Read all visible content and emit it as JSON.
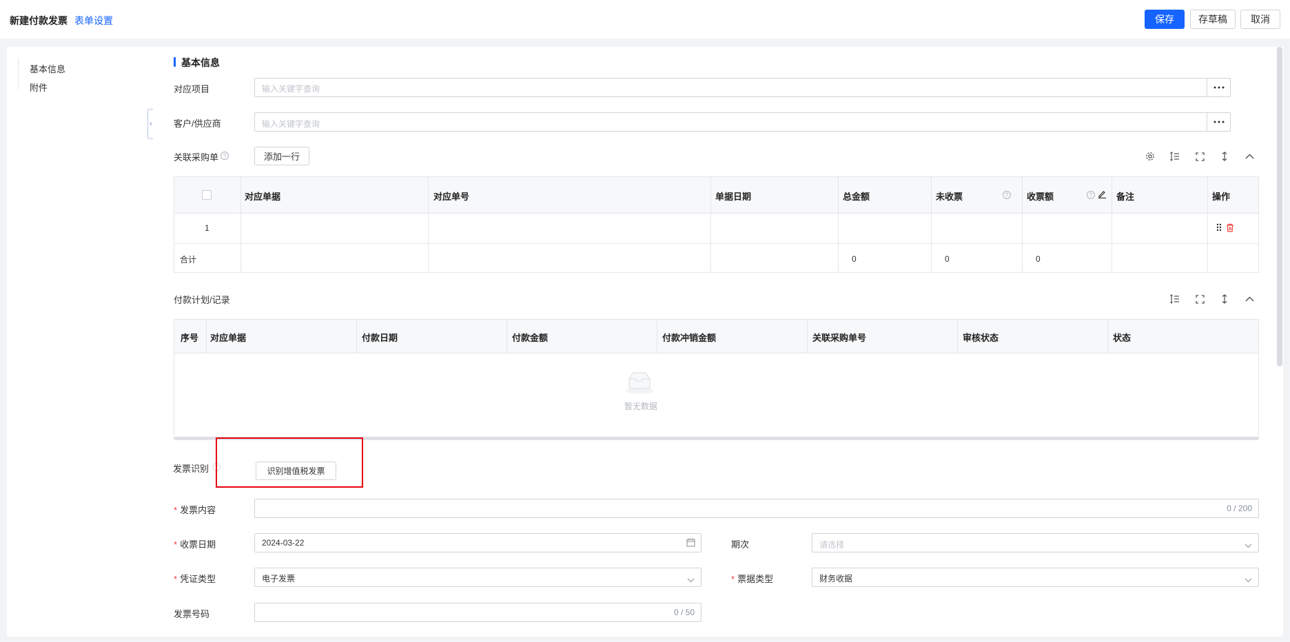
{
  "header": {
    "title": "新建付款发票",
    "form_settings": "表单设置",
    "save": "保存",
    "draft": "存草稿",
    "cancel": "取消"
  },
  "sidebar": {
    "items": [
      {
        "label": "基本信息"
      },
      {
        "label": "附件"
      }
    ]
  },
  "basic": {
    "section_title": "基本信息",
    "project": {
      "label": "对应项目",
      "placeholder": "输入关键字查询"
    },
    "customer": {
      "label": "客户/供应商",
      "placeholder": "输入关键字查询"
    }
  },
  "purchase": {
    "label": "关联采购单",
    "add_row": "添加一行",
    "columns": [
      "对应单据",
      "对应单号",
      "单据日期",
      "总金额",
      "未收票",
      "收票额",
      "备注",
      "操作"
    ],
    "rows": [
      {
        "index": "1"
      }
    ],
    "total": {
      "label": "合计",
      "total_amount": "0",
      "unbilled": "0",
      "billed": "0"
    }
  },
  "payment_plan": {
    "label": "付款计划/记录",
    "columns": [
      "序号",
      "对应单据",
      "付款日期",
      "付款金额",
      "付款冲销金额",
      "关联采购单号",
      "审核状态",
      "状态"
    ],
    "empty": "暂无数据"
  },
  "invoice": {
    "recognize_label": "发票识别",
    "recognize_button": "识别增值税发票",
    "content": {
      "label": "发票内容",
      "counter": "0 / 200"
    },
    "date": {
      "label": "收票日期",
      "value": "2024-03-22"
    },
    "period": {
      "label": "期次",
      "placeholder": "请选择"
    },
    "voucher": {
      "label": "凭证类型",
      "value": "电子发票"
    },
    "ticket_type": {
      "label": "票据类型",
      "value": "财务收据"
    },
    "number": {
      "label": "发票号码",
      "counter": "0 / 50"
    }
  },
  "colors": {
    "accent": "#1664ff",
    "required": "#f53f3f",
    "highlight": "#e60012"
  }
}
